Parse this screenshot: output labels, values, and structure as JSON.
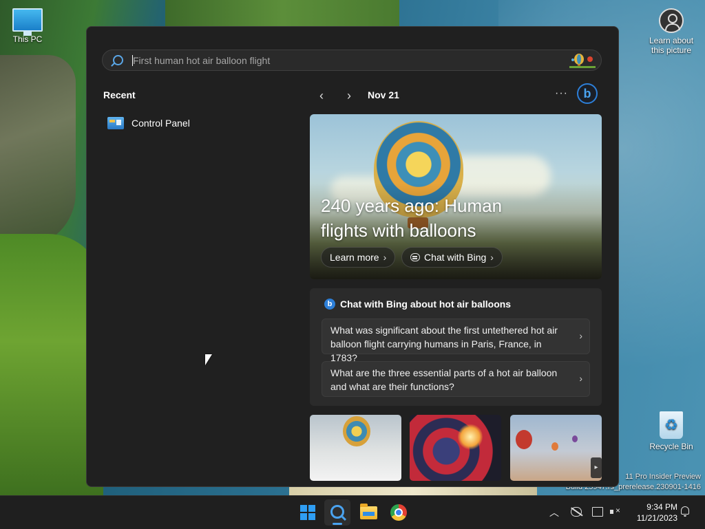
{
  "desktop": {
    "icons": {
      "this_pc": "This PC",
      "learn_about": "Learn about this picture",
      "recycle_bin": "Recycle Bin"
    },
    "watermark_line1": "11 Pro Insider Preview",
    "watermark_line2": "Build 25947.rs_prerelease.230901-1416"
  },
  "search": {
    "placeholder": "First human hot air balloon flight"
  },
  "recent": {
    "title": "Recent",
    "items": [
      {
        "label": "Control Panel",
        "icon": "control-panel-icon"
      }
    ]
  },
  "highlights": {
    "date": "Nov 21",
    "more_label": "···",
    "hero": {
      "title": "240 years ago: Human flights with balloons",
      "learn_more": "Learn more",
      "chat_with_bing": "Chat with Bing"
    },
    "chat": {
      "heading": "Chat with Bing about hot air balloons",
      "questions": [
        "What was significant about the first untethered hot air balloon flight carrying humans in Paris, France, in 1783?",
        "What are the three essential parts of a hot air balloon and what are their functions?"
      ]
    }
  },
  "taskbar": {
    "time": "9:34 PM",
    "date": "11/21/2023"
  },
  "colors": {
    "panel_bg": "#202020",
    "card_bg": "#2b2b2b",
    "accent": "#4aa3f0"
  }
}
